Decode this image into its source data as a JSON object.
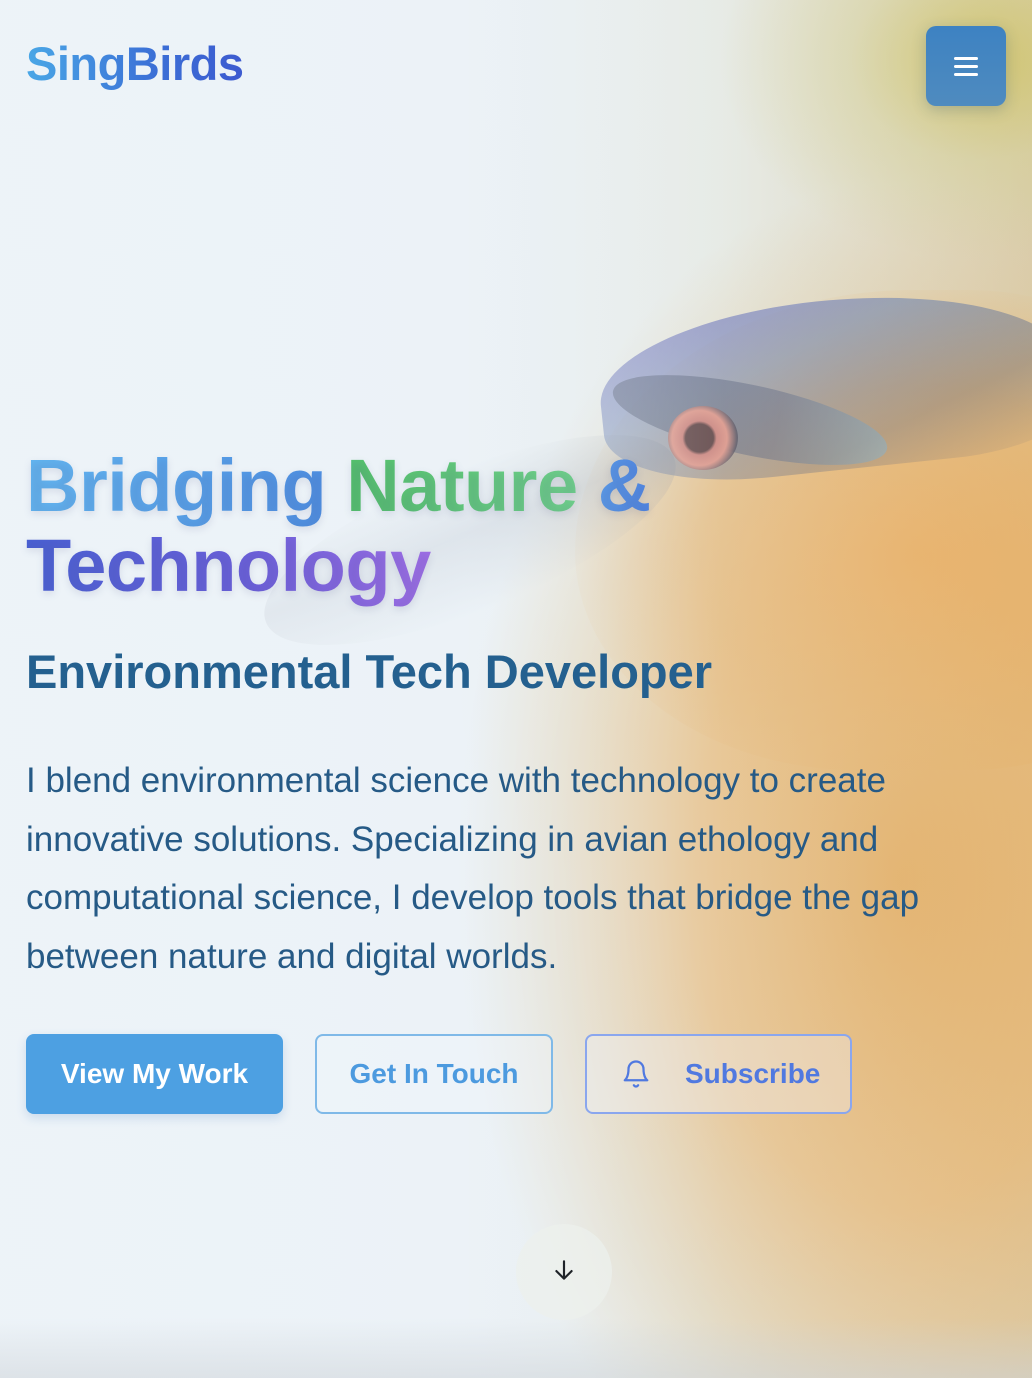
{
  "header": {
    "logo_text": "SingBirds",
    "menu_icon": "hamburger-menu-icon"
  },
  "hero": {
    "headline": {
      "part1": "Bridging",
      "part2": "Nature",
      "part3": "&",
      "part4": "Technology"
    },
    "subtitle": "Environmental Tech Developer",
    "description": "I blend environmental science with technology to create innovative solutions. Specializing in avian ethology and computational science, I develop tools that bridge the gap between nature and digital worlds.",
    "buttons": {
      "primary_label": "View My Work",
      "contact_label": "Get In Touch",
      "subscribe_label": "Subscribe",
      "subscribe_icon": "bell-icon"
    },
    "scroll_icon": "arrow-down-icon"
  },
  "colors": {
    "primary_blue": "#4da0e2",
    "nav_button": "#3d82c2",
    "subtitle_text": "#24608f",
    "body_text": "#265a86",
    "green_accent": "#53c26a",
    "purple_accent": "#9f6ee6"
  }
}
